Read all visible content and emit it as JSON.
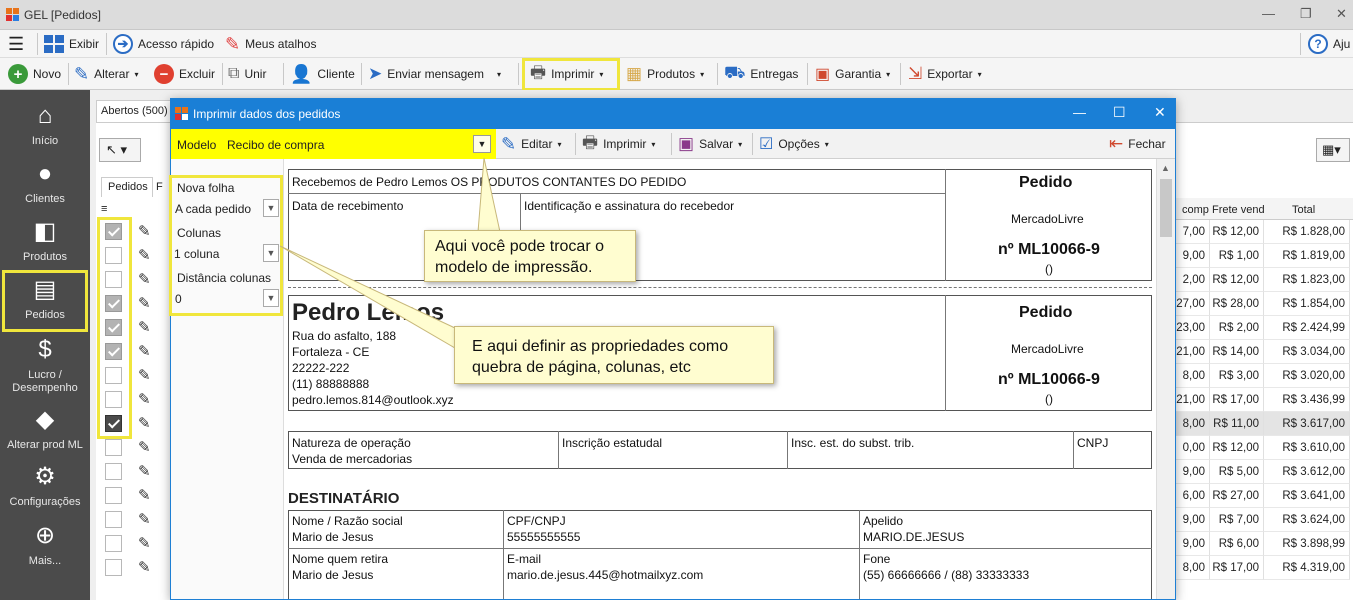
{
  "window": {
    "title": "GEL [Pedidos]"
  },
  "menubar": {
    "exibir": "Exibir",
    "acesso_rapido": "Acesso rápido",
    "meus_atalhos": "Meus atalhos",
    "ajuda": "Aju"
  },
  "toolbar": {
    "novo": "Novo",
    "alterar": "Alterar",
    "excluir": "Excluir",
    "unir": "Unir",
    "cliente": "Cliente",
    "enviar_mensagem": "Enviar mensagem",
    "imprimir": "Imprimir",
    "produtos": "Produtos",
    "entregas": "Entregas",
    "garantia": "Garantia",
    "exportar": "Exportar"
  },
  "sidebar": {
    "items": [
      {
        "label": "Início",
        "icon": "home-icon"
      },
      {
        "label": "Clientes",
        "icon": "user-icon"
      },
      {
        "label": "Produtos",
        "icon": "box-icon"
      },
      {
        "label": "Pedidos",
        "icon": "list-icon"
      },
      {
        "label": "Lucro /",
        "label2": "Desempenho",
        "icon": "dollar-icon"
      },
      {
        "label": "Alterar prod ML",
        "icon": "tag-icon"
      },
      {
        "label": "Configurações",
        "icon": "gear-icon"
      },
      {
        "label": "Mais...",
        "icon": "plus-icon"
      }
    ]
  },
  "main": {
    "tab_abertos": "Abertos (500)",
    "subtab_pedidos": "Pedidos",
    "subtab_f": "F",
    "columns": {
      "comp": "comp",
      "frete": "Frete vend",
      "total": "Total"
    },
    "rows": [
      {
        "checked": "on",
        "comp": "7,00",
        "frete": "R$ 12,00",
        "total": "R$ 1.828,00"
      },
      {
        "checked": "off",
        "comp": "9,00",
        "frete": "R$ 1,00",
        "total": "R$ 1.819,00"
      },
      {
        "checked": "off",
        "comp": "2,00",
        "frete": "R$ 12,00",
        "total": "R$ 1.823,00"
      },
      {
        "checked": "on",
        "comp": "27,00",
        "frete": "R$ 28,00",
        "total": "R$ 1.854,00"
      },
      {
        "checked": "on",
        "comp": "23,00",
        "frete": "R$ 2,00",
        "total": "R$ 2.424,99"
      },
      {
        "checked": "on",
        "comp": "21,00",
        "frete": "R$ 14,00",
        "total": "R$ 3.034,00"
      },
      {
        "checked": "off",
        "comp": "8,00",
        "frete": "R$ 3,00",
        "total": "R$ 3.020,00"
      },
      {
        "checked": "off",
        "comp": "21,00",
        "frete": "R$ 17,00",
        "total": "R$ 3.436,99"
      },
      {
        "checked": "dark",
        "comp": "8,00",
        "frete": "R$ 11,00",
        "total": "R$ 3.617,00"
      },
      {
        "checked": "off",
        "comp": "0,00",
        "frete": "R$ 12,00",
        "total": "R$ 3.610,00"
      },
      {
        "checked": "off",
        "comp": "9,00",
        "frete": "R$ 5,00",
        "total": "R$ 3.612,00"
      },
      {
        "checked": "off",
        "comp": "6,00",
        "frete": "R$ 27,00",
        "total": "R$ 3.641,00"
      },
      {
        "checked": "off",
        "comp": "9,00",
        "frete": "R$ 7,00",
        "total": "R$ 3.624,00"
      },
      {
        "checked": "off",
        "comp": "9,00",
        "frete": "R$ 6,00",
        "total": "R$ 3.898,99"
      },
      {
        "checked": "off",
        "comp": "8,00",
        "frete": "R$ 17,00",
        "total": "R$ 4.319,00"
      }
    ]
  },
  "dialog": {
    "title": "Imprimir dados dos pedidos",
    "modelo_label": "Modelo",
    "modelo_value": "Recibo de compra",
    "editar": "Editar",
    "imprimir": "Imprimir",
    "salvar": "Salvar",
    "opcoes": "Opções",
    "fechar": "Fechar",
    "nova_folha_label": "Nova folha",
    "nova_folha_value": "A cada pedido",
    "colunas_label": "Colunas",
    "colunas_value": "1 coluna",
    "distancia_label": "Distância colunas",
    "distancia_value": "0"
  },
  "preview": {
    "recebemos": "Recebemos de Pedro Lemos OS PRODUTOS CONTANTES DO PEDIDO",
    "data_recebimento": "Data de recebimento",
    "identificacao": "Identificação e assinatura do recebedor",
    "pedido_heading": "Pedido",
    "canal": "MercadoLivre",
    "numero": "nº ML10066-9",
    "paren": "()",
    "name": "Pedro Lemos",
    "address": "Rua do asfalto, 188",
    "city": "Fortaleza - CE",
    "cep": "22222-222",
    "phone": "(11) 88888888",
    "email": "pedro.lemos.814@outlook.xyz",
    "natureza_label": "Natureza de operação",
    "natureza_value": "Venda de mercadorias",
    "inscricao_estadual": "Inscrição estatudal",
    "inscricao_subst": "Insc. est. do subst. trib.",
    "cnpj": "CNPJ",
    "destinatario": "DESTINATÁRIO",
    "nome_label": "Nome / Razão social",
    "nome_value": "Mario de Jesus",
    "cpf_label": "CPF/CNPJ",
    "cpf_value": "55555555555",
    "apelido_label": "Apelido",
    "apelido_value": "MARIO.DE.JESUS",
    "retira_label": "Nome quem retira",
    "retira_value": "Mario de Jesus",
    "email_label": "E-mail",
    "email_value": "mario.de.jesus.445@hotmailxyz.com",
    "fone_label": "Fone",
    "fone_value": "(55) 66666666 / (88) 33333333"
  },
  "callouts": {
    "modelo_tip": "Aqui você pode trocar o modelo de impressão.",
    "props_tip": "E aqui definir as propriedades como quebra de página, colunas, etc"
  }
}
